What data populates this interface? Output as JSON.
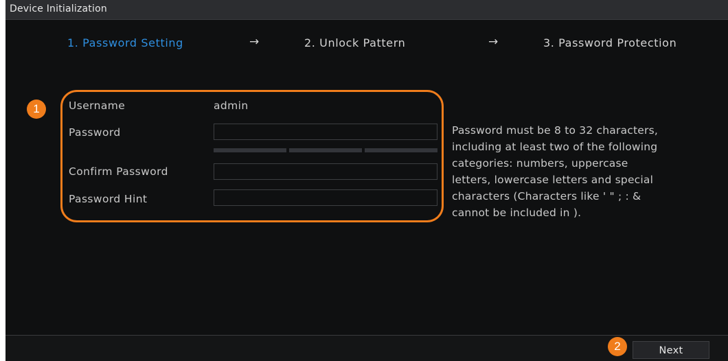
{
  "window": {
    "title": "Device Initialization"
  },
  "steps": [
    {
      "label": "1.  Password Setting",
      "active": true
    },
    {
      "label": "2.  Unlock Pattern",
      "active": false
    },
    {
      "label": "3.  Password Protection",
      "active": false
    }
  ],
  "step_separator": "→",
  "form": {
    "username_label": "Username",
    "username_value": "admin",
    "password_label": "Password",
    "password_value": "",
    "confirm_label": "Confirm Password",
    "confirm_value": "",
    "hint_label": "Password Hint",
    "hint_value": "",
    "strength_segments_filled": 0,
    "strength_segments_total": 3
  },
  "requirements_text": "Password must be 8 to 32 characters,\nincluding at least two of the following\ncategories: numbers, uppercase\nletters, lowercase letters and special\ncharacters  (Characters like ' \" ; : &\ncannot be included in ).",
  "annotations": {
    "badge_1": "1",
    "badge_2": "2"
  },
  "footer": {
    "next_label": "Next"
  },
  "colors": {
    "background": "#0f1011",
    "titlebar": "#2c2d30",
    "active_step": "#2f8fe0",
    "inactive_step": "#d4d4d4",
    "label_text": "#c9c9c9",
    "annotation_orange": "#f07d1c",
    "strength_empty": "#33353a",
    "divider": "#3a3b3e",
    "footer_bar": "#141516"
  }
}
